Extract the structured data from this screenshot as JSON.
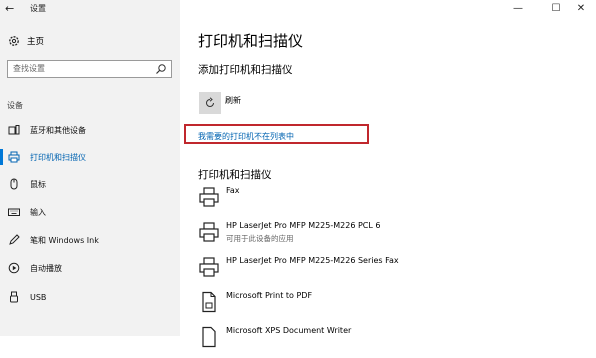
{
  "window": {
    "title": "设置",
    "back_glyph": "←",
    "minimize_glyph": "—",
    "maximize_glyph": "☐",
    "close_glyph": "✕"
  },
  "sidebar": {
    "home_label": "主页",
    "search_placeholder": "查找设置",
    "section_label": "设备",
    "items": [
      {
        "label": "蓝牙和其他设备",
        "icon": "bluetooth-devices-icon"
      },
      {
        "label": "打印机和扫描仪",
        "icon": "printer-icon",
        "active": true
      },
      {
        "label": "鼠标",
        "icon": "mouse-icon"
      },
      {
        "label": "输入",
        "icon": "keyboard-icon"
      },
      {
        "label": "笔和 Windows Ink",
        "icon": "pen-icon"
      },
      {
        "label": "自动播放",
        "icon": "autoplay-icon"
      },
      {
        "label": "USB",
        "icon": "usb-icon"
      }
    ]
  },
  "main": {
    "title": "打印机和扫描仪",
    "add_heading": "添加打印机和扫描仪",
    "refresh_label": "刷新",
    "not_listed_link": "我需要的打印机不在列表中",
    "list_heading": "打印机和扫描仪",
    "devices": [
      {
        "name": "Fax",
        "status": "",
        "icon": "printer-icon"
      },
      {
        "name": "HP LaserJet Pro MFP M225-M226 PCL 6",
        "status": "可用于此设备的应用",
        "icon": "printer-icon"
      },
      {
        "name": "HP LaserJet Pro MFP M225-M226 Series Fax",
        "status": "",
        "icon": "printer-icon"
      },
      {
        "name": "Microsoft Print to PDF",
        "status": "",
        "icon": "pdf-printer-icon"
      },
      {
        "name": "Microsoft XPS Document Writer",
        "status": "",
        "icon": "xps-printer-icon"
      }
    ]
  },
  "colors": {
    "accent": "#0078d7",
    "link": "#0063b1",
    "highlight_box": "#c0272d",
    "sidebar_bg": "#f2f2f2"
  }
}
